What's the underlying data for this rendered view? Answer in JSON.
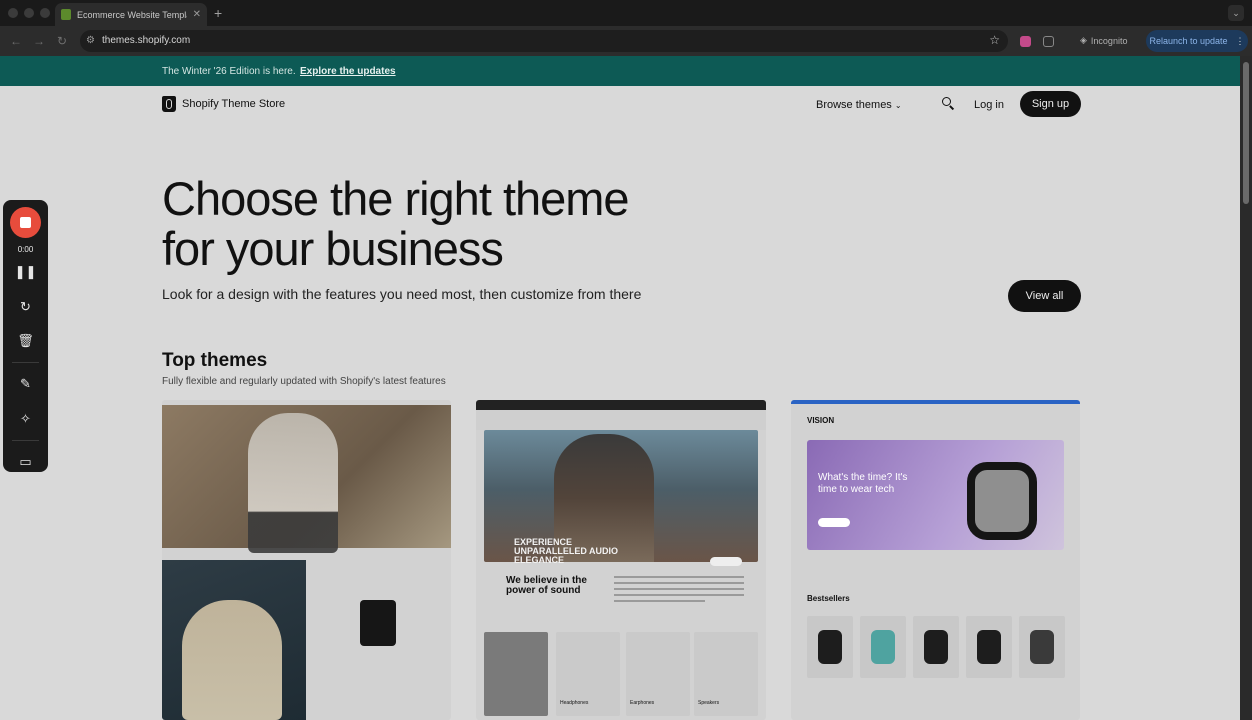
{
  "browser": {
    "tab_title": "Ecommerce Website Templat",
    "url": "themes.shopify.com",
    "incognito_label": "Incognito",
    "relaunch_label": "Relaunch to update",
    "icons": [
      "back-icon",
      "forward-icon",
      "reload-icon",
      "tune-icon",
      "star-icon",
      "extension-icon",
      "incognito-icon",
      "more-icon"
    ]
  },
  "announcement": {
    "text": "The Winter '26 Edition is here.",
    "link": "Explore the updates"
  },
  "header": {
    "logo_text": "Shopify Theme Store",
    "browse": "Browse themes",
    "login": "Log in",
    "signup": "Sign up"
  },
  "hero": {
    "title_line1": "Choose the right theme",
    "title_line2": "for your business",
    "subtitle": "Look for a design with the features you need most, then customize from there",
    "view_all": "View all"
  },
  "top_themes": {
    "title": "Top themes",
    "subtitle": "Fully flexible and regularly updated with Shopify's latest features",
    "card_b": {
      "headline1": "EXPERIENCE",
      "headline2": "UNPARALLELED AUDIO",
      "headline3": "ELEGANCE",
      "believe1": "We believe in the",
      "believe2": "power of sound",
      "products": [
        "Headphones",
        "Earphones",
        "Speakers"
      ]
    },
    "card_c": {
      "logo": "VISION",
      "banner1": "What's the time? It's",
      "banner2": "time to wear tech",
      "bestsellers": "Bestsellers"
    }
  },
  "recorder": {
    "timer": "0:00"
  },
  "colors": {
    "announcement_bg": "#0d5a55",
    "recorder_stop": "#e74c3c",
    "relaunch_bg": "#1d3a5c"
  }
}
